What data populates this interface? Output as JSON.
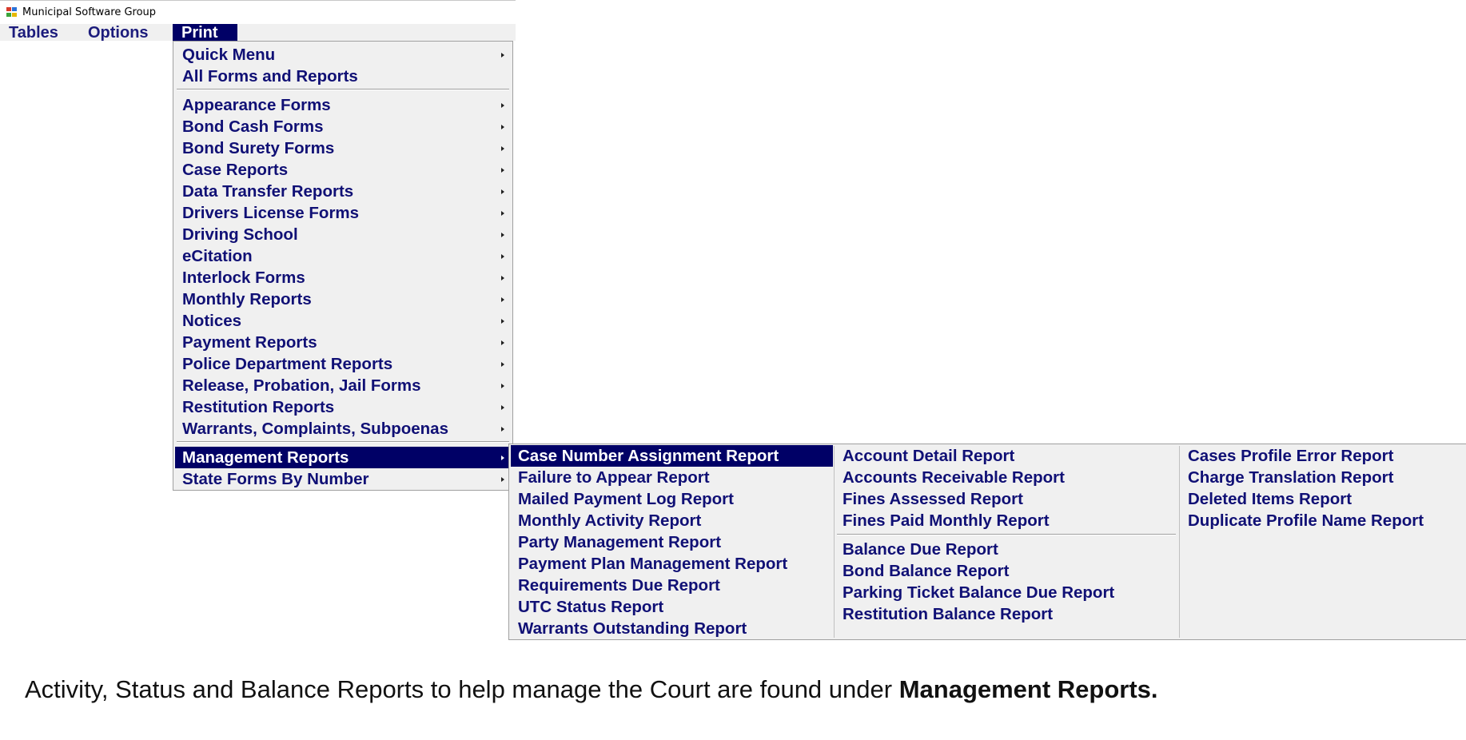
{
  "window": {
    "title": "Municipal Software Group",
    "icon": "app-icon"
  },
  "menubar": {
    "items": [
      "Tables",
      "Options",
      "Print"
    ],
    "active": "Print"
  },
  "print_menu": {
    "group1": [
      "Quick Menu",
      "All Forms and Reports"
    ],
    "group2": [
      "Appearance Forms",
      "Bond Cash Forms",
      "Bond Surety Forms",
      "Case Reports",
      "Data Transfer Reports",
      "Drivers License Forms",
      "Driving School",
      "eCitation",
      "Interlock Forms",
      "Monthly Reports",
      "Notices",
      "Payment Reports",
      "Police Department Reports",
      "Release, Probation, Jail Forms",
      "Restitution Reports",
      "Warrants, Complaints, Subpoenas"
    ],
    "group3": [
      "Management Reports",
      "State Forms By Number"
    ],
    "selected": "Management Reports"
  },
  "management_menu": {
    "column1": [
      "Case Number Assignment Report",
      "Failure to Appear Report",
      "Mailed Payment Log Report",
      "Monthly Activity Report",
      "Party Management Report",
      "Payment Plan Management Report",
      "Requirements Due Report",
      "UTC Status Report",
      "Warrants Outstanding Report"
    ],
    "column2_top": [
      "Account Detail Report",
      "Accounts Receivable Report",
      "Fines Assessed Report",
      "Fines Paid Monthly Report"
    ],
    "column2_bottom": [
      "Balance Due Report",
      "Bond Balance Report",
      "Parking Ticket Balance Due Report",
      "Restitution Balance Report"
    ],
    "column3": [
      "Cases Profile Error Report",
      "Charge Translation Report",
      "Deleted Items Report",
      "Duplicate Profile Name Report"
    ],
    "selected": "Case Number Assignment Report"
  },
  "caption": {
    "text": "Activity, Status and Balance Reports to help manage the Court are found under ",
    "bold": "Management Reports."
  },
  "colors": {
    "menu_bg": "#f0f0f0",
    "highlight": "#000066",
    "menu_text": "#101075"
  }
}
